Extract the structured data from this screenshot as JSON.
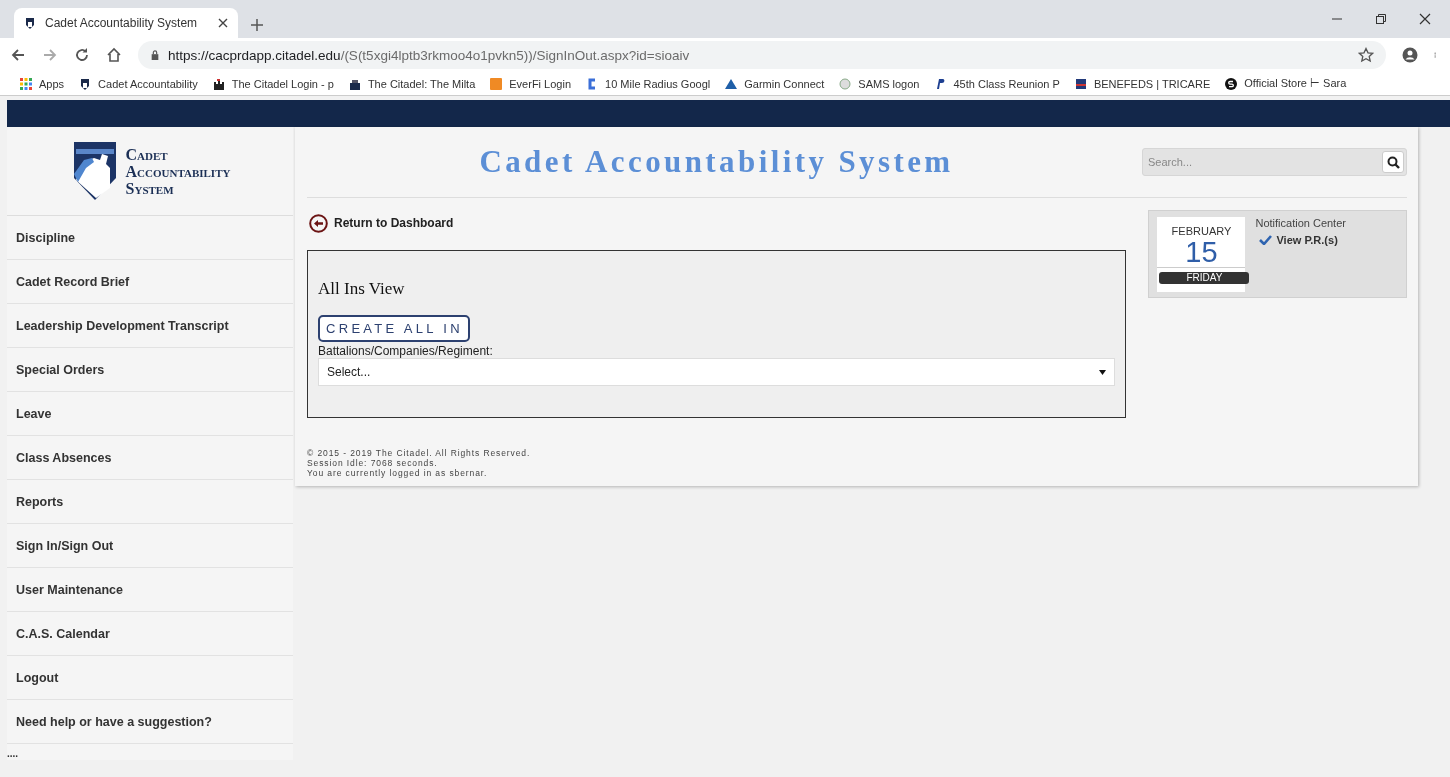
{
  "browser": {
    "tab": {
      "title": "Cadet Accountability System",
      "selected": true
    },
    "url": {
      "host": "https://cacprdapp.citadel.edu",
      "path": "/(S(t5xgi4lptb3rkmoo4o1pvkn5))/SignInOut.aspx?id=sioaiv"
    },
    "bookmarks": [
      {
        "label": "Apps",
        "kind": "apps"
      },
      {
        "label": "Cadet Accountability",
        "kind": "shield"
      },
      {
        "label": "The Citadel Login - p",
        "kind": "castle"
      },
      {
        "label": "The Citadel: The Milta",
        "kind": "castle2"
      },
      {
        "label": "EverFi Login",
        "kind": "everfi"
      },
      {
        "label": "10 Mile Radius Googl",
        "kind": "c"
      },
      {
        "label": "Garmin Connect",
        "kind": "triangle"
      },
      {
        "label": "SAMS logon",
        "kind": "globe"
      },
      {
        "label": "45th Class Reunion P",
        "kind": "paypal"
      },
      {
        "label": "BENEFEDS | TRICARE",
        "kind": "flag"
      },
      {
        "label": "Official Store ⊢ Sara",
        "kind": "s"
      }
    ]
  },
  "logo": {
    "lines": [
      "Cadet",
      "Accountability",
      "System"
    ]
  },
  "sidebar": {
    "items": [
      {
        "label": "Discipline"
      },
      {
        "label": "Cadet Record Brief"
      },
      {
        "label": "Leadership Development Transcript"
      },
      {
        "label": "Special Orders"
      },
      {
        "label": "Leave"
      },
      {
        "label": "Class Absences"
      },
      {
        "label": "Reports"
      },
      {
        "label": "Sign In/Sign Out"
      },
      {
        "label": "User Maintenance"
      },
      {
        "label": "C.A.S. Calendar"
      },
      {
        "label": "Logout"
      },
      {
        "label": "Need help or have a suggestion?"
      }
    ],
    "more": "...."
  },
  "header": {
    "title": "Cadet Accountability System",
    "search": {
      "placeholder": "Search..."
    }
  },
  "return_link": "Return to Dashboard",
  "panel": {
    "title": "All Ins View",
    "button": "CREATE ALL IN",
    "select_label": "Battalions/Companies/Regiment:",
    "select_value": "Select..."
  },
  "calendar": {
    "month": "FEBRUARY",
    "day": "15",
    "weekday": "FRIDAY"
  },
  "notifications": {
    "title": "Notification Center",
    "items": [
      "View P.R.(s)"
    ]
  },
  "footer": [
    "©  2015 - 2019 The Citadel. All Rights Reserved.",
    "Session Idle: 7068 seconds.",
    "You are currently logged in as sbernar."
  ]
}
